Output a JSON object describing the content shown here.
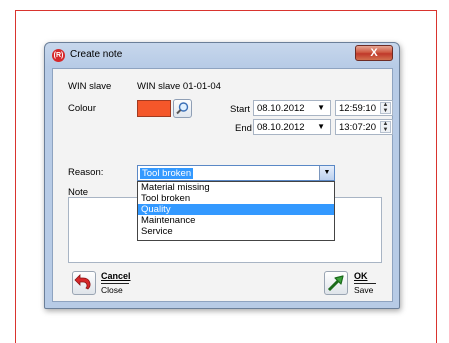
{
  "window": {
    "title": "Create note",
    "close_glyph": "X",
    "app_icon_text": "(R)"
  },
  "fields": {
    "slave_label": "WIN slave",
    "slave_value": "WIN slave 01-01-04",
    "colour_label": "Colour",
    "colour_value": "#f4572a",
    "start_label": "Start",
    "start_date": "08.10.2012",
    "start_time": "12:59:10",
    "end_label": "End",
    "end_date": "08.10.2012",
    "end_time": "13:07:20",
    "reason_label": "Reason:",
    "reason_selected": "Tool broken",
    "note_label": "Note",
    "note_value": ""
  },
  "reason_options": [
    {
      "label": "Material missing",
      "highlighted": false
    },
    {
      "label": "Tool broken",
      "highlighted": false
    },
    {
      "label": "Quality",
      "highlighted": true
    },
    {
      "label": "Maintenance",
      "highlighted": false
    },
    {
      "label": "Service",
      "highlighted": false
    }
  ],
  "buttons": {
    "cancel_label": "Cancel",
    "cancel_sub": "Close",
    "ok_label": "OK",
    "ok_sub": "Save"
  },
  "colors": {
    "accent_frame": "#d9342e",
    "selection": "#3399ff"
  }
}
